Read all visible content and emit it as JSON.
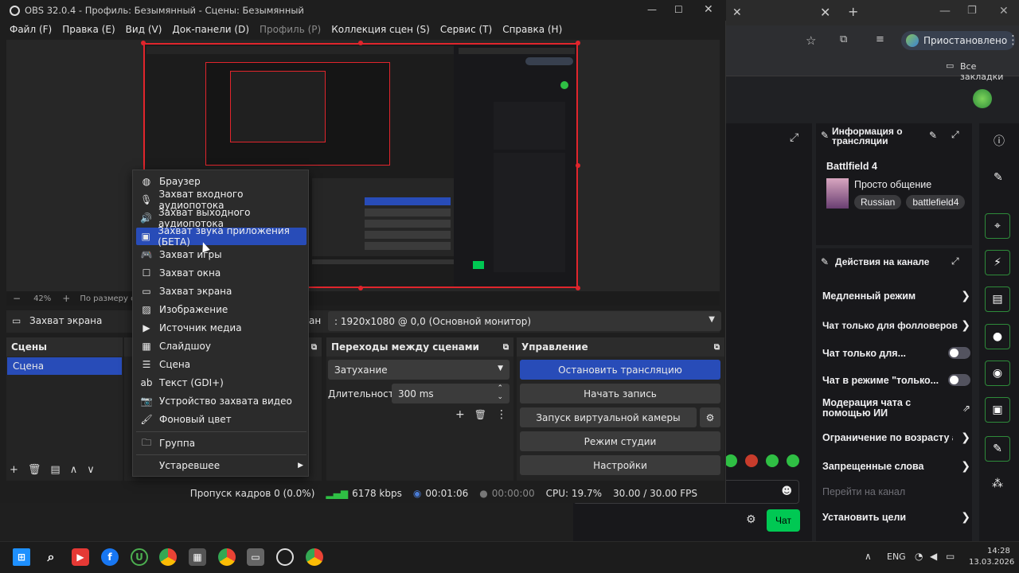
{
  "obs": {
    "title": "OBS 32.0.4 - Профиль: Безымянный - Сцены: Безымянный",
    "menu": [
      {
        "label": "Файл (F)",
        "disabled": false
      },
      {
        "label": "Правка (E)",
        "disabled": false
      },
      {
        "label": "Вид (V)",
        "disabled": false
      },
      {
        "label": "Док-панели (D)",
        "disabled": false
      },
      {
        "label": "Профиль (P)",
        "disabled": true
      },
      {
        "label": "Коллекция сцен (S)",
        "disabled": false
      },
      {
        "label": "Сервис (T)",
        "disabled": false
      },
      {
        "label": "Справка (H)",
        "disabled": false
      }
    ],
    "zoom": {
      "value": "42%",
      "fit_label": "По размеру окна"
    },
    "source": {
      "name": "Захват экрана",
      "screen_label": "ан",
      "screen_value": ": 1920x1080 @ 0,0 (Основной монитор)"
    },
    "scenes": {
      "title": "Сцены",
      "items": [
        "Сцена"
      ]
    },
    "transitions": {
      "title": "Переходы между сценами",
      "type": "Затухание",
      "duration_label": "Длительность",
      "duration_value": "300 ms"
    },
    "controls": {
      "title": "Управление",
      "stop_stream": "Остановить трансляцию",
      "start_record": "Начать запись",
      "virtual_cam": "Запуск виртуальной камеры",
      "studio_mode": "Режим студии",
      "settings": "Настройки"
    },
    "status": {
      "dropped": "Пропуск кадров 0 (0.0%)",
      "bitrate": "6178 kbps",
      "stream_time": "00:01:06",
      "rec_time": "00:00:00",
      "cpu": "CPU: 19.7%",
      "fps": "30.00 / 30.00 FPS"
    },
    "context_menu": [
      {
        "label": "Браузер",
        "icon": "globe-icon"
      },
      {
        "label": "Захват входного аудиопотока",
        "icon": "mic-icon"
      },
      {
        "label": "Захват выходного аудиопотока",
        "icon": "speaker-icon"
      },
      {
        "label": "Захват звука приложения (БЕТА)",
        "icon": "app-window-icon",
        "selected": true
      },
      {
        "label": "Захват игры",
        "icon": "gamepad-icon"
      },
      {
        "label": "Захват окна",
        "icon": "window-icon"
      },
      {
        "label": "Захват экрана",
        "icon": "monitor-icon"
      },
      {
        "label": "Изображение",
        "icon": "image-icon"
      },
      {
        "label": "Источник медиа",
        "icon": "play-icon"
      },
      {
        "label": "Слайдшоу",
        "icon": "slideshow-icon"
      },
      {
        "label": "Сцена",
        "icon": "list-icon"
      },
      {
        "label": "Текст (GDI+)",
        "icon": "text-icon"
      },
      {
        "label": "Устройство захвата видео",
        "icon": "camera-icon"
      },
      {
        "label": "Фоновый цвет",
        "icon": "brush-icon"
      },
      {
        "label": "Группа",
        "icon": "folder-icon"
      },
      {
        "label": "Устаревшее",
        "icon": "submenu-arrow-icon"
      }
    ]
  },
  "browser": {
    "profile_label": "Приостановлено",
    "bookmarks": "Все закладки"
  },
  "twitch": {
    "info_title": "Информация о трансляции",
    "stream_title": "Battlfield 4",
    "category": "Просто общение",
    "tags": [
      "Russian",
      "battlefield4"
    ],
    "actions_title": "Действия на канале",
    "actions": [
      {
        "label": "Медленный режим",
        "kind": "arrow"
      },
      {
        "label": "Чат только для фолловеров",
        "kind": "arrow"
      },
      {
        "label": "Чат только для...",
        "kind": "toggle"
      },
      {
        "label": "Чат в режиме \"только...",
        "kind": "toggle"
      },
      {
        "label": "Модерация чата с помощью ИИ",
        "kind": "external"
      },
      {
        "label": "Ограничение по возрасту а",
        "kind": "arrow"
      },
      {
        "label": "Запрещенные слова",
        "kind": "arrow"
      },
      {
        "label": "Перейти на канал",
        "kind": "muted"
      },
      {
        "label": "Установить цели",
        "kind": "arrow"
      }
    ],
    "chat_button": "Чат"
  },
  "taskbar": {
    "lang": "ENG",
    "time": "14:28",
    "date": "13.03.2026"
  },
  "colors": {
    "accent": "#284cb8",
    "twitch_green": "#00c853",
    "preview_border": "#e0252c"
  }
}
